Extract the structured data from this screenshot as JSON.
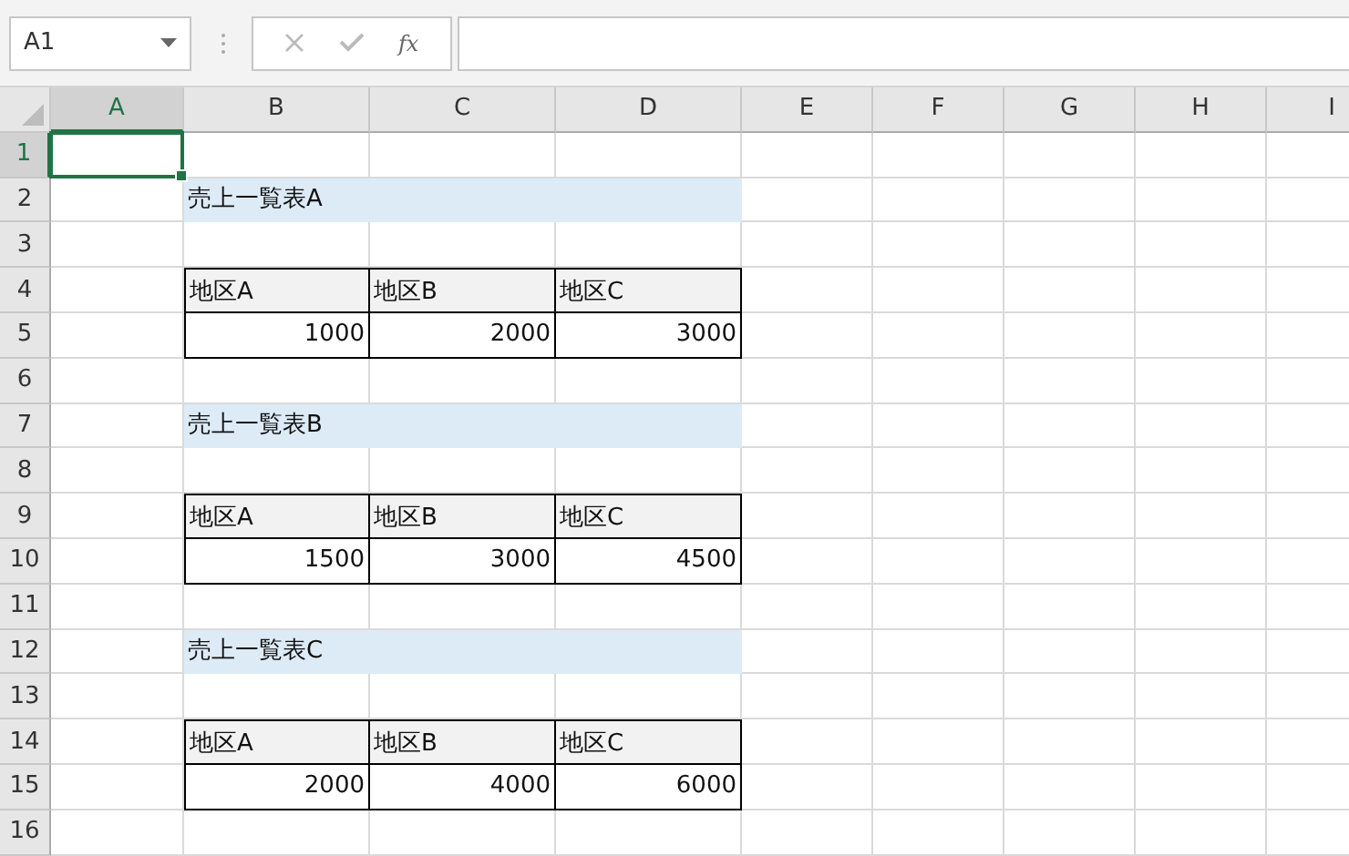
{
  "name_box": {
    "value": "A1"
  },
  "formula_bar": {
    "fx": "fx"
  },
  "columns": [
    {
      "label": "A",
      "selected": true
    },
    {
      "label": "B",
      "selected": false
    },
    {
      "label": "C",
      "selected": false
    },
    {
      "label": "D",
      "selected": false
    },
    {
      "label": "E",
      "selected": false
    },
    {
      "label": "F",
      "selected": false
    },
    {
      "label": "G",
      "selected": false
    },
    {
      "label": "H",
      "selected": false
    },
    {
      "label": "I",
      "selected": false
    }
  ],
  "rows": [
    {
      "number": "1",
      "selected": true,
      "cells": []
    },
    {
      "number": "2",
      "selected": false,
      "cells": [
        {
          "kind": "empty"
        },
        {
          "kind": "title",
          "text": "売上一覧表A"
        },
        {
          "kind": "fill"
        },
        {
          "kind": "fill"
        }
      ]
    },
    {
      "number": "3",
      "selected": false,
      "cells": []
    },
    {
      "number": "4",
      "selected": false,
      "cells": [
        {
          "kind": "empty"
        },
        {
          "kind": "header",
          "text": "地区A"
        },
        {
          "kind": "header",
          "text": "地区B"
        },
        {
          "kind": "header",
          "text": "地区C"
        }
      ]
    },
    {
      "number": "5",
      "selected": false,
      "cells": [
        {
          "kind": "empty"
        },
        {
          "kind": "value",
          "text": "1000"
        },
        {
          "kind": "value",
          "text": "2000"
        },
        {
          "kind": "value",
          "text": "3000"
        }
      ]
    },
    {
      "number": "6",
      "selected": false,
      "cells": []
    },
    {
      "number": "7",
      "selected": false,
      "cells": [
        {
          "kind": "empty"
        },
        {
          "kind": "title",
          "text": "売上一覧表B"
        },
        {
          "kind": "fill"
        },
        {
          "kind": "fill"
        }
      ]
    },
    {
      "number": "8",
      "selected": false,
      "cells": []
    },
    {
      "number": "9",
      "selected": false,
      "cells": [
        {
          "kind": "empty"
        },
        {
          "kind": "header",
          "text": "地区A"
        },
        {
          "kind": "header",
          "text": "地区B"
        },
        {
          "kind": "header",
          "text": "地区C"
        }
      ]
    },
    {
      "number": "10",
      "selected": false,
      "cells": [
        {
          "kind": "empty"
        },
        {
          "kind": "value",
          "text": "1500"
        },
        {
          "kind": "value",
          "text": "3000"
        },
        {
          "kind": "value",
          "text": "4500"
        }
      ]
    },
    {
      "number": "11",
      "selected": false,
      "cells": []
    },
    {
      "number": "12",
      "selected": false,
      "cells": [
        {
          "kind": "empty"
        },
        {
          "kind": "title",
          "text": "売上一覧表C"
        },
        {
          "kind": "fill"
        },
        {
          "kind": "fill"
        }
      ]
    },
    {
      "number": "13",
      "selected": false,
      "cells": []
    },
    {
      "number": "14",
      "selected": false,
      "cells": [
        {
          "kind": "empty"
        },
        {
          "kind": "header",
          "text": "地区A"
        },
        {
          "kind": "header",
          "text": "地区B"
        },
        {
          "kind": "header",
          "text": "地区C"
        }
      ]
    },
    {
      "number": "15",
      "selected": false,
      "cells": [
        {
          "kind": "empty"
        },
        {
          "kind": "value",
          "text": "2000"
        },
        {
          "kind": "value",
          "text": "4000"
        },
        {
          "kind": "value",
          "text": "6000"
        }
      ]
    },
    {
      "number": "16",
      "selected": false,
      "cells": []
    }
  ]
}
